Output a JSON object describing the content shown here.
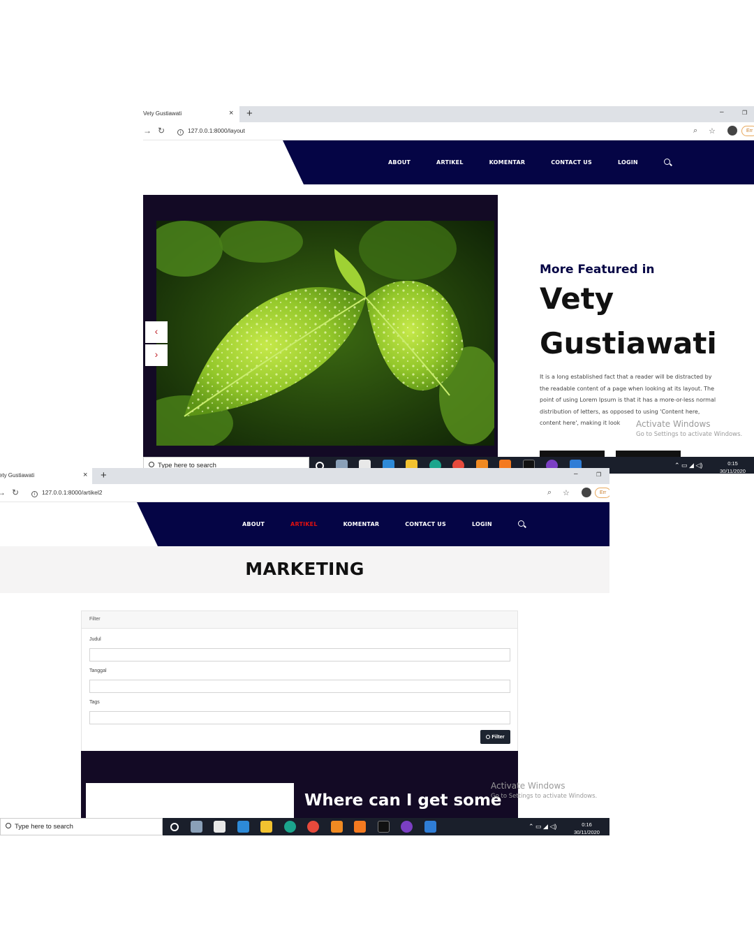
{
  "windows": [
    {
      "tab_title": "Vety Gustiawati",
      "url": "127.0.0.1:8000/layout",
      "nav": [
        "ABOUT",
        "ARTIKEL",
        "KOMENTAR",
        "CONTACT US",
        "LOGIN"
      ],
      "active_nav": "",
      "featured": {
        "kicker": "More Featured in",
        "name_line1": "Vety",
        "name_line2": "Gustiawati",
        "body": "It is a long established fact that a reader will be distracted by the readable content of a page when looking at its layout. The point of using Lorem Ipsum is that it has a more-or-less normal distribution of letters, as opposed to using 'Content here, content here', making it look"
      },
      "slider": {
        "prev": "‹",
        "next": "›"
      },
      "activate": {
        "line1": "Activate Windows",
        "line2": "Go to Settings to activate Windows."
      },
      "taskbar": {
        "search_placeholder": "Type here to search",
        "time": "0:15",
        "date": "30/11/2020"
      }
    },
    {
      "tab_title": "Vety Gustiawati",
      "url": "127.0.0.1:8000/artikel2",
      "nav": [
        "ABOUT",
        "ARTIKEL",
        "KOMENTAR",
        "CONTACT US",
        "LOGIN"
      ],
      "active_nav": "ARTIKEL",
      "page_title": "MARKETING",
      "filter": {
        "header": "Filter",
        "fields": [
          "Judul",
          "Tanggal",
          "Tags"
        ],
        "button": "Filter"
      },
      "post_title": "Where can I get some",
      "activate": {
        "line1": "Activate Windows",
        "line2": "Go to Settings to activate Windows."
      },
      "taskbar": {
        "search_placeholder": "Type here to search",
        "time": "0:16",
        "date": "30/11/2020"
      }
    }
  ],
  "chrome": {
    "new_tab": "+",
    "close": "×",
    "minimize": "–",
    "restore": "❐",
    "back": "←",
    "forward": "→",
    "reload": "↻",
    "zoom": "⌕",
    "star": "☆",
    "profile_pill": "Err"
  },
  "colors": {
    "nav_bg": "#050545",
    "hero_bg": "#130a25",
    "active_link": "#e01010",
    "taskbar_bg": "#1a1f2b"
  }
}
